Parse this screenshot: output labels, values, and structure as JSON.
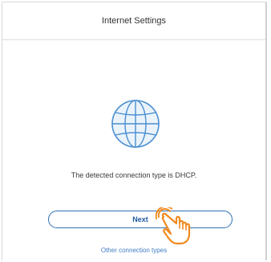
{
  "header": {
    "title": "Internet Settings"
  },
  "content": {
    "icon": "globe-icon",
    "status_text": "The detected connection type is DHCP."
  },
  "actions": {
    "next_label": "Next",
    "other_link_label": "Other connection types"
  },
  "overlay": {
    "icon": "tap-hand-icon"
  },
  "colors": {
    "accent": "#2f6fb2",
    "globe": "#4a8fd0",
    "globe_fill": "#eaf3fb",
    "hand": "#f08a1e"
  }
}
